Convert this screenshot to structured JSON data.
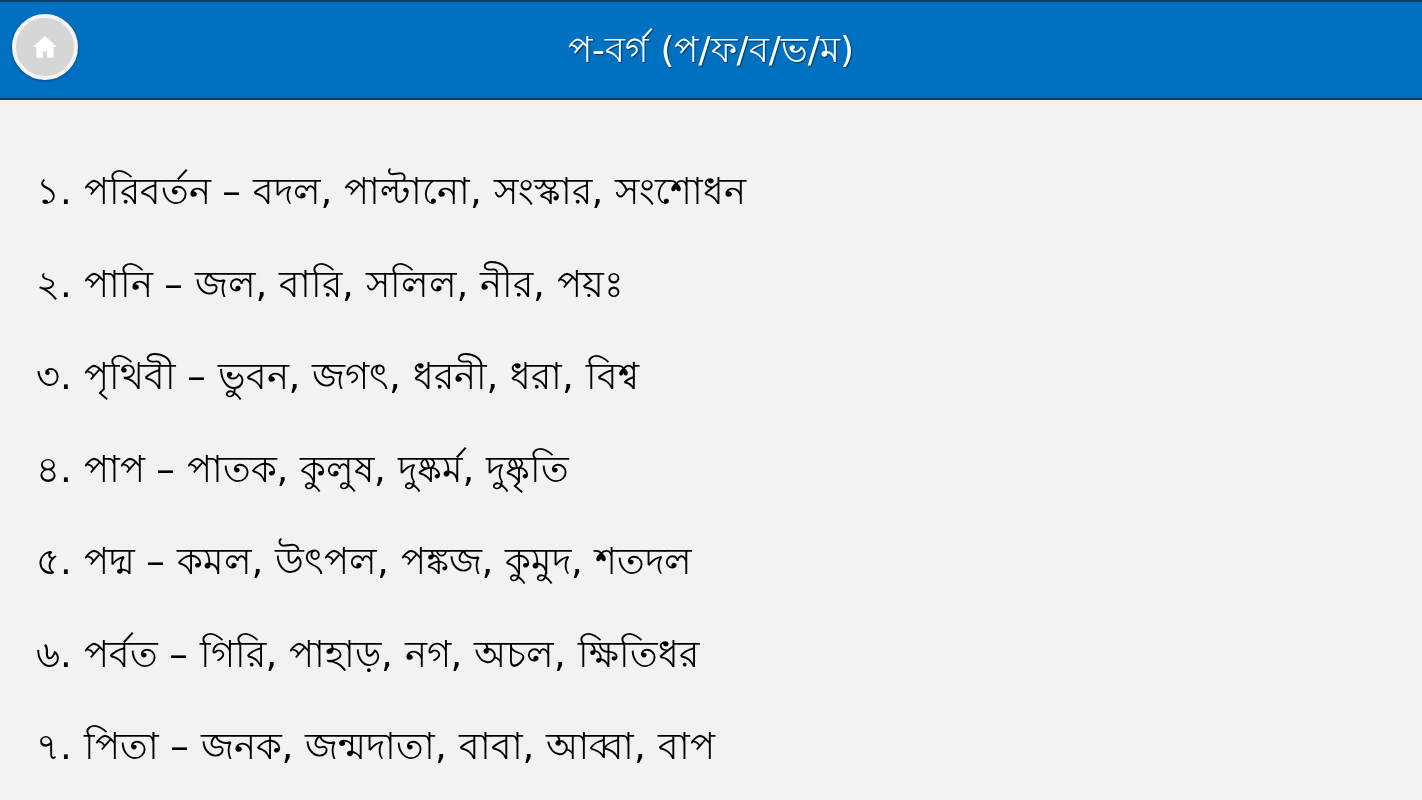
{
  "header": {
    "title": "প-বর্গ (প/ফ/ব/ভ/ম)"
  },
  "items": [
    {
      "text": "১. পরিবর্তন – বদল, পাল্টানো, সংস্কার, সংশোধন"
    },
    {
      "text": "২. পানি – জল, বারি, সলিল, নীর, পয়ঃ"
    },
    {
      "text": "৩. পৃথিবী – ভুবন, জগৎ, ধরনী, ধরা, বিশ্ব"
    },
    {
      "text": "৪. পাপ – পাতক, কুলুষ, দুষ্কর্ম, দুষ্কৃতি"
    },
    {
      "text": "৫. পদ্ম – কমল, উৎপল, পঙ্কজ, কুমুদ, শতদল"
    },
    {
      "text": "৬. পর্বত – গিরি, পাহাড়, নগ, অচল, ক্ষিতিধর"
    },
    {
      "text": "৭. পিতা – জনক, জন্মদাতা, বাবা, আব্বা, বাপ"
    }
  ]
}
